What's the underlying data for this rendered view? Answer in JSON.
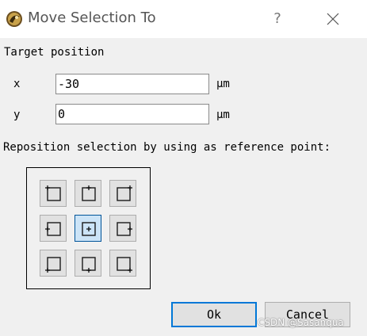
{
  "window": {
    "title": "Move Selection To",
    "help_glyph": "?",
    "app_icon": "app-logo-icon",
    "close_icon": "close-icon"
  },
  "target": {
    "heading": "Target position",
    "x_label": "x",
    "x_value": "-30",
    "y_label": "y",
    "y_value": "0",
    "unit": "µm"
  },
  "reference": {
    "heading": "Reposition selection by using as reference point:",
    "points": [
      {
        "name": "ref-point-top-left",
        "active": false
      },
      {
        "name": "ref-point-top-center",
        "active": false
      },
      {
        "name": "ref-point-top-right",
        "active": false
      },
      {
        "name": "ref-point-middle-left",
        "active": false
      },
      {
        "name": "ref-point-center",
        "active": true
      },
      {
        "name": "ref-point-middle-right",
        "active": false
      },
      {
        "name": "ref-point-bottom-left",
        "active": false
      },
      {
        "name": "ref-point-bottom-center",
        "active": false
      },
      {
        "name": "ref-point-bottom-right",
        "active": false
      }
    ]
  },
  "buttons": {
    "ok": "Ok",
    "cancel": "Cancel"
  },
  "watermark": "CSDN @Sasanqua"
}
